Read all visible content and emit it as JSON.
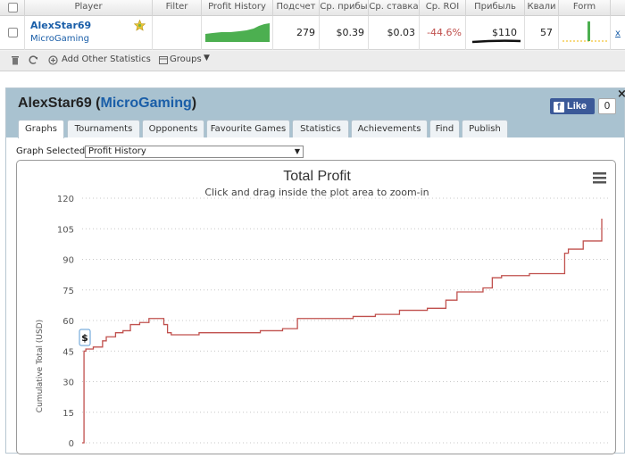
{
  "table": {
    "headers": [
      "Player",
      "Filter",
      "Profit History",
      "Подсчет",
      "Ср. прибы",
      "Ср. ставка",
      "Ср. ROI",
      "Прибыль",
      "Квали",
      "Form"
    ],
    "row": {
      "player_name": "AlexStar69",
      "network": "MicroGaming",
      "count": "279",
      "avg_profit": "$0.39",
      "avg_stake": "$0.03",
      "avg_roi": "-44.6%",
      "profit": "$110",
      "qualification": "57",
      "remove": "x"
    },
    "footer": {
      "add_stats": "Add Other Statistics",
      "groups": "Groups"
    }
  },
  "panel": {
    "player_name": "AlexStar69",
    "network": "MicroGaming",
    "like_label": "Like",
    "like_count": "0",
    "close": "×",
    "tabs": [
      "Graphs",
      "Tournaments",
      "Opponents",
      "Favourite Games",
      "Statistics",
      "Achievements",
      "Find",
      "Publish"
    ],
    "active_tab": "Graphs",
    "graph_select_label": "Graph Selected:",
    "graph_select_value": "Profit History",
    "tooltip": "$"
  },
  "colors": {
    "line": "#c0504d",
    "accent_blue": "#1a5ea8",
    "roi_red": "#c0504d",
    "header_bg": "#a9c2d0",
    "sparkline_green": "#4caf50"
  },
  "chart_data": {
    "type": "line",
    "title": "Total Profit",
    "subtitle": "Click and drag inside the plot area to zoom-in",
    "ylabel": "Cumulative Total (USD)",
    "ylim": [
      0,
      120
    ],
    "yticks": [
      0,
      15,
      30,
      45,
      60,
      75,
      90,
      105,
      120
    ],
    "grid": true,
    "x": [
      0,
      1,
      2,
      4,
      6,
      8,
      11,
      13,
      18,
      22,
      26,
      31,
      36,
      41,
      44,
      46,
      48,
      52,
      63,
      76,
      96,
      101,
      108,
      116,
      128,
      146,
      158,
      166,
      171,
      186,
      196,
      202,
      216,
      221,
      226,
      241,
      256,
      260,
      262,
      270,
      276,
      280
    ],
    "values": [
      0,
      45,
      46,
      46,
      47,
      47,
      50,
      52,
      54,
      55,
      58,
      59,
      61,
      61,
      58,
      54,
      53,
      53,
      54,
      54,
      55,
      55,
      56,
      61,
      61,
      62,
      63,
      63,
      65,
      66,
      70,
      74,
      76,
      81,
      82,
      83,
      83,
      93,
      95,
      99,
      99,
      110
    ]
  }
}
